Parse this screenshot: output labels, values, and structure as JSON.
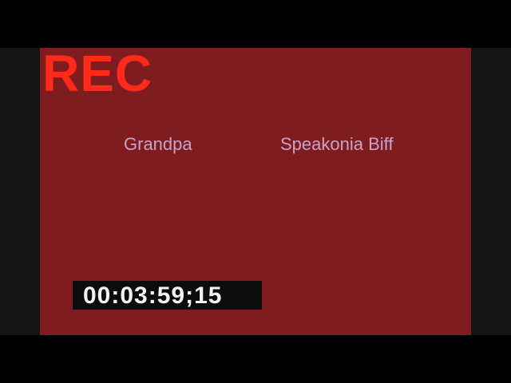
{
  "recording": {
    "indicator": "REC",
    "timecode": "00:03:59;15"
  },
  "participants": {
    "left": "Grandpa",
    "right": "Speakonia Biff"
  },
  "colors": {
    "frame_background": "#7e1c20",
    "rec_indicator": "#ff2a1a",
    "name_text": "#c8a3c6",
    "timecode_text": "#f2f2f2",
    "timecode_background": "#0c0c0c"
  }
}
